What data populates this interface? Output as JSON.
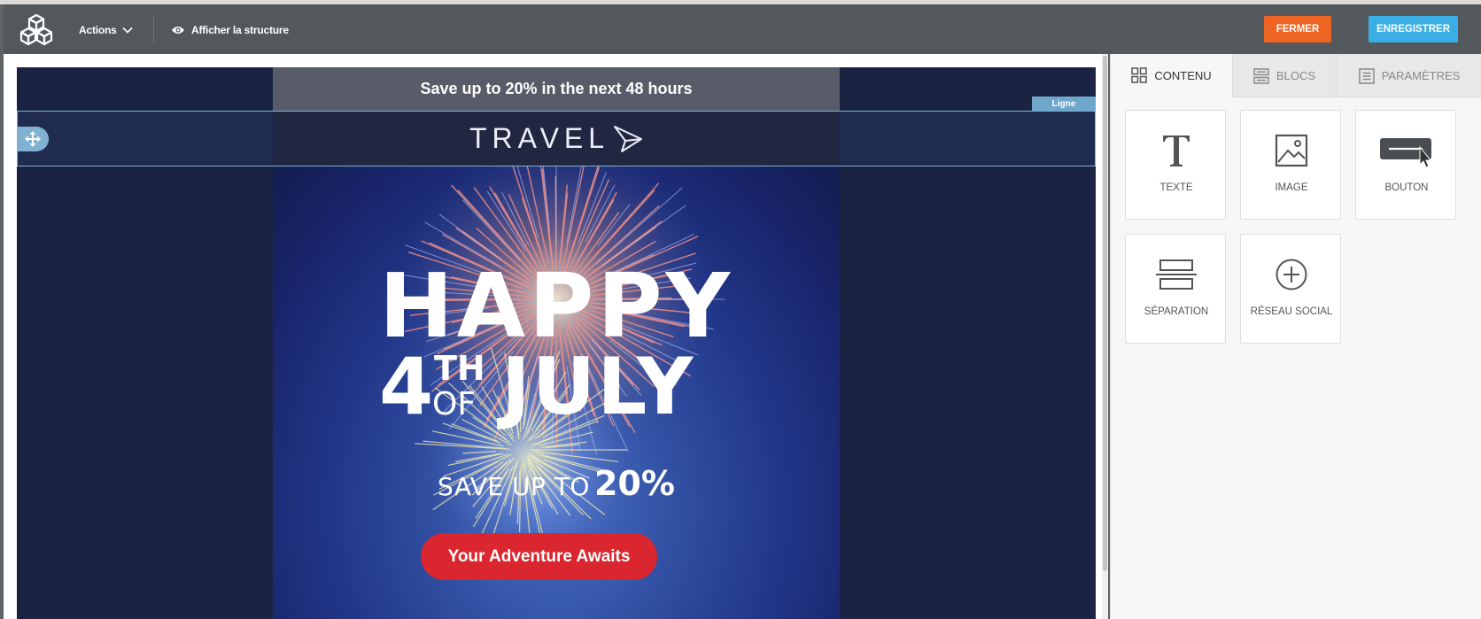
{
  "toolbar": {
    "actions_label": "Actions",
    "structure_label": "Afficher la structure",
    "close_label": "FERMER",
    "save_label": "ENREGISTRER",
    "close_color": "#ee6423",
    "save_color": "#3aaee5"
  },
  "email": {
    "banner_text": "Save up to 20% in the next 48 hours",
    "logo_text": "TRAVEL",
    "hero": {
      "line1": "HAPPY",
      "four": "4",
      "th": "TH",
      "of": "OF",
      "july": "JULY",
      "save_prefix": "SAVE UP TO",
      "save_value": "20%"
    },
    "cta_label": "Your Adventure Awaits",
    "cta_color": "#d9262f"
  },
  "canvas": {
    "row_tag": "Ligne"
  },
  "panel": {
    "tabs": [
      {
        "label": "CONTENU",
        "icon": "grid-icon",
        "active": true
      },
      {
        "label": "BLOCS",
        "icon": "blocks-icon",
        "active": false
      },
      {
        "label": "PARAMÈTRES",
        "icon": "settings-doc-icon",
        "active": false
      }
    ],
    "tiles": [
      {
        "label": "TEXTE",
        "icon": "text-icon"
      },
      {
        "label": "IMAGE",
        "icon": "image-icon"
      },
      {
        "label": "BOUTON",
        "icon": "button-icon"
      },
      {
        "label": "SÉPARATION",
        "icon": "divider-icon"
      },
      {
        "label": "RÉSEAU SOCIAL",
        "icon": "plus-circle-icon"
      }
    ]
  }
}
